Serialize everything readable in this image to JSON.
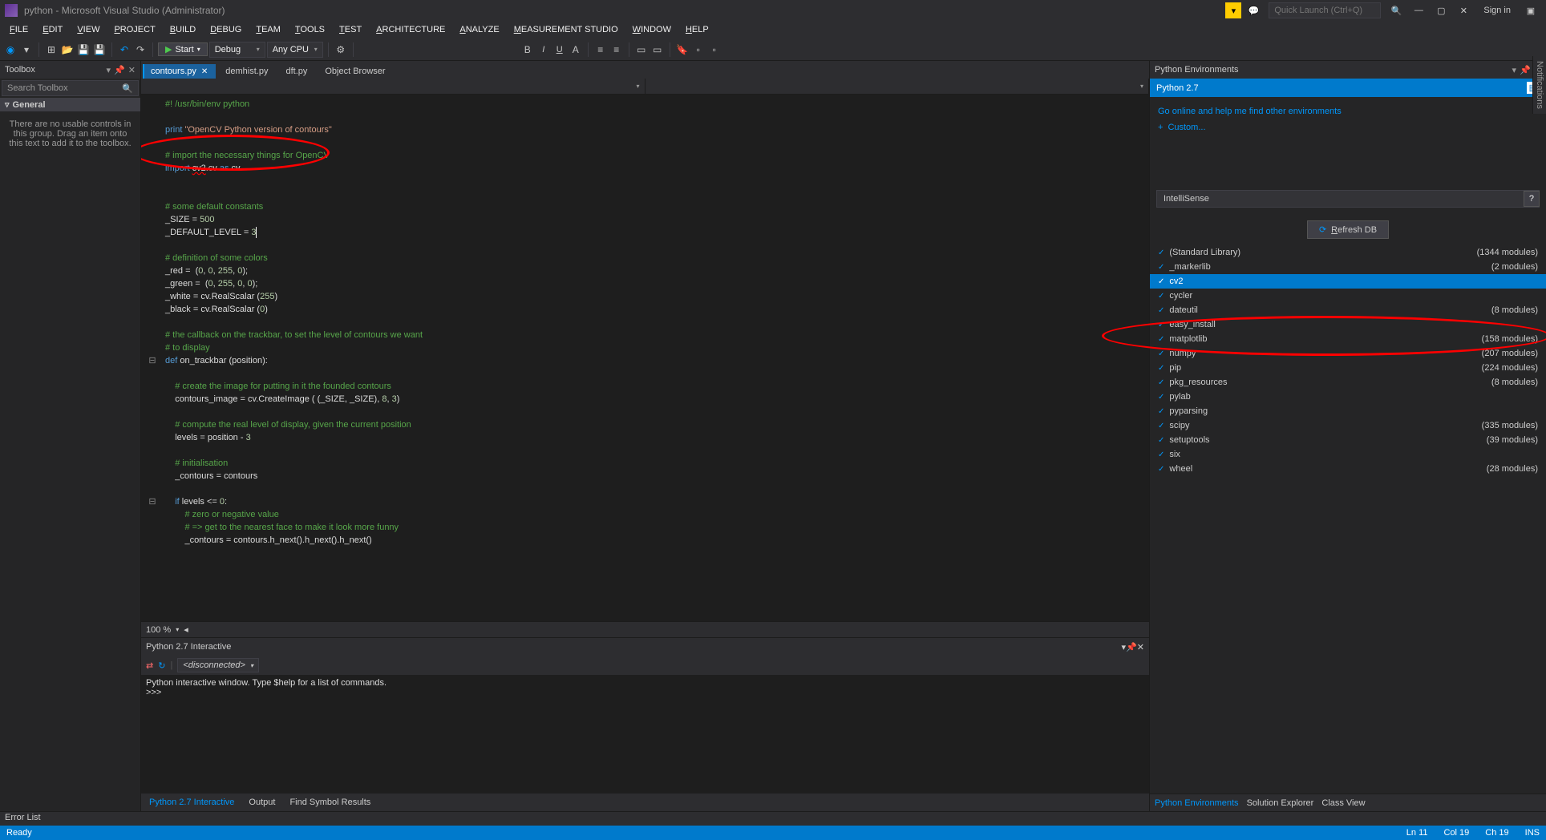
{
  "title": "python - Microsoft Visual Studio (Administrator)",
  "quick_launch": "Quick Launch (Ctrl+Q)",
  "sign_in": "Sign in",
  "menu": [
    "FILE",
    "EDIT",
    "VIEW",
    "PROJECT",
    "BUILD",
    "DEBUG",
    "TEAM",
    "TOOLS",
    "TEST",
    "ARCHITECTURE",
    "ANALYZE",
    "MEASUREMENT STUDIO",
    "WINDOW",
    "HELP"
  ],
  "toolbar": {
    "start": "Start",
    "debug": "Debug",
    "cpu": "Any CPU"
  },
  "toolbox": {
    "header": "Toolbox",
    "search": "Search Toolbox",
    "group": "General",
    "empty": "There are no usable controls in this group. Drag an item onto this text to add it to the toolbox."
  },
  "tabs": [
    {
      "label": "contours.py",
      "active": true
    },
    {
      "label": "demhist.py",
      "active": false
    },
    {
      "label": "dft.py",
      "active": false
    },
    {
      "label": "Object Browser",
      "active": false
    }
  ],
  "interactive": {
    "title": "Python 2.7 Interactive",
    "state": "<disconnected>",
    "line1": "Python interactive window. Type $help for a list of commands.",
    "line2": ">>>"
  },
  "bottom_tabs": [
    {
      "label": "Python 2.7 Interactive",
      "active": true
    },
    {
      "label": "Output",
      "active": false
    },
    {
      "label": "Find Symbol Results",
      "active": false
    }
  ],
  "pyenv": {
    "header": "Python Environments",
    "env": "Python 2.7",
    "link1": "Go online and help me find other environments",
    "custom": "Custom...",
    "intelli": "IntelliSense",
    "refresh": "Refresh DB",
    "modules": [
      {
        "name": "(Standard Library)",
        "count": "(1344 modules)"
      },
      {
        "name": "_markerlib",
        "count": "(2 modules)"
      },
      {
        "name": "cv2",
        "count": "",
        "sel": true
      },
      {
        "name": "cycler",
        "count": ""
      },
      {
        "name": "dateutil",
        "count": "(8 modules)"
      },
      {
        "name": "easy_install",
        "count": ""
      },
      {
        "name": "matplotlib",
        "count": "(158 modules)"
      },
      {
        "name": "numpy",
        "count": "(207 modules)"
      },
      {
        "name": "pip",
        "count": "(224 modules)"
      },
      {
        "name": "pkg_resources",
        "count": "(8 modules)"
      },
      {
        "name": "pylab",
        "count": ""
      },
      {
        "name": "pyparsing",
        "count": ""
      },
      {
        "name": "scipy",
        "count": "(335 modules)"
      },
      {
        "name": "setuptools",
        "count": "(39 modules)"
      },
      {
        "name": "six",
        "count": ""
      },
      {
        "name": "wheel",
        "count": "(28 modules)"
      }
    ],
    "tabs": [
      {
        "label": "Python Environments",
        "active": true
      },
      {
        "label": "Solution Explorer",
        "active": false
      },
      {
        "label": "Class View",
        "active": false
      }
    ]
  },
  "notifications": "Notifications",
  "errorlist": "Error List",
  "status": {
    "ready": "Ready",
    "ln": "Ln 11",
    "col": "Col 19",
    "ch": "Ch 19",
    "ins": "INS"
  },
  "zoom": "100 %"
}
